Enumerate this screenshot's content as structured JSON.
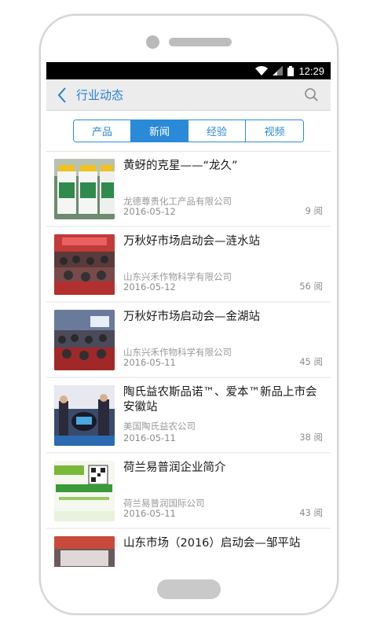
{
  "status_bar": {
    "time": "12:29"
  },
  "header": {
    "title": "行业动态"
  },
  "tabs": [
    {
      "label": "产品",
      "active": false
    },
    {
      "label": "新闻",
      "active": true
    },
    {
      "label": "经验",
      "active": false
    },
    {
      "label": "视频",
      "active": false
    }
  ],
  "news": [
    {
      "title": "黄蚜的克星——“龙久”",
      "source": "龙德尊贵化工产品有限公司",
      "date": "2016-05-12",
      "reads": "9 阅"
    },
    {
      "title": "万秋好市场启动会—涟水站",
      "source": "山东兴禾作物科学有限公司",
      "date": "2016-05-12",
      "reads": "56 阅"
    },
    {
      "title": "万秋好市场启动会—金湖站",
      "source": "山东兴禾作物科学有限公司",
      "date": "2016-05-11",
      "reads": "45 阅"
    },
    {
      "title": "陶氏益农斯品诺™、爱本™新品上市会安徽站",
      "source": "美国陶氏益农公司",
      "date": "2016-05-11",
      "reads": "38 阅"
    },
    {
      "title": "荷兰易普润企业简介",
      "source": "荷兰易普润国际公司",
      "date": "2016-05-11",
      "reads": "43 阅"
    },
    {
      "title": "山东市场（2016）启动会—邹平站",
      "source": "",
      "date": "",
      "reads": ""
    }
  ],
  "colors": {
    "accent": "#2b8ad8",
    "status_bar": "#000000",
    "header_bg": "#ececec"
  }
}
